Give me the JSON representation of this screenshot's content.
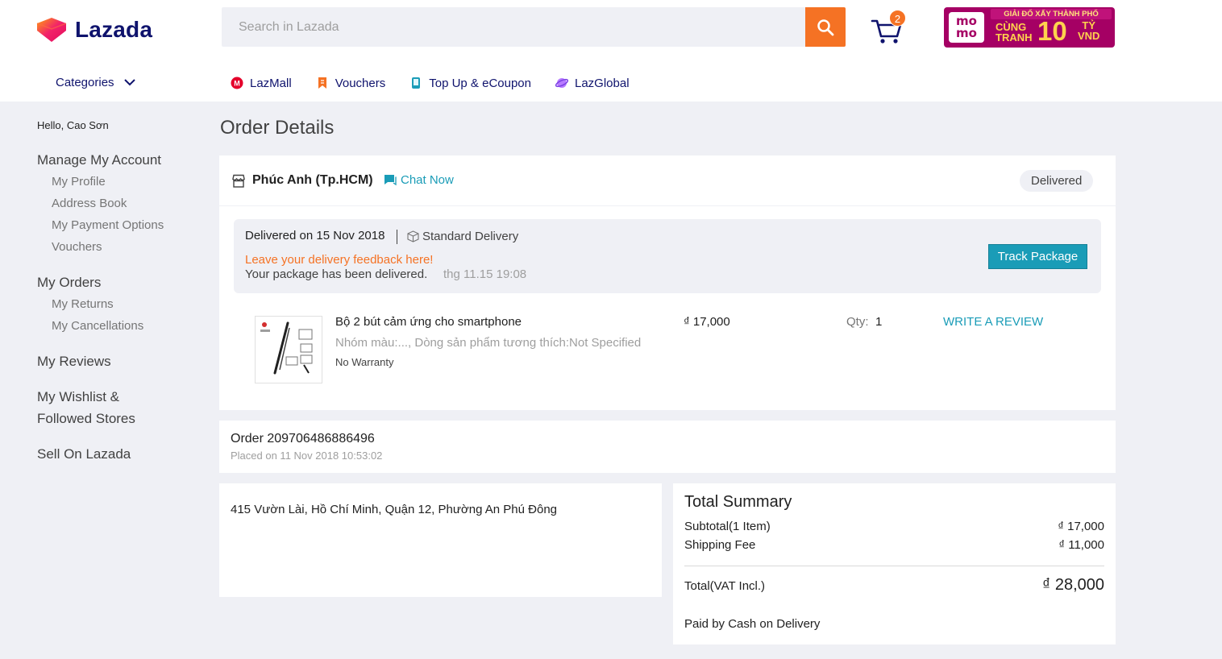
{
  "header": {
    "brand": "Lazada",
    "search": {
      "placeholder": "Search in Lazada",
      "value": ""
    },
    "cart_count": "2",
    "promo": {
      "line1": "GIẢI ĐỐ XẤY THÀNH PHỐ",
      "logo": "mo mo",
      "cung": "CÙNG",
      "tranh": "TRANH",
      "big": "10",
      "ty": "TỶ",
      "vnd": "VND"
    },
    "categories_label": "Categories",
    "nav": [
      {
        "label": "LazMall",
        "icon": "lazmall-icon",
        "color": "#e4002b"
      },
      {
        "label": "Vouchers",
        "icon": "voucher-icon",
        "color": "#f57224"
      },
      {
        "label": "Top Up & eCoupon",
        "icon": "topup-icon",
        "color": "#1a9cb7"
      },
      {
        "label": "LazGlobal",
        "icon": "lazglobal-icon",
        "color": "#7b3fe4"
      }
    ]
  },
  "sidebar": {
    "greeting": "Hello, Cao Sơn",
    "manage_account": "Manage My Account",
    "account_items": [
      "My Profile",
      "Address Book",
      "My Payment Options",
      "Vouchers"
    ],
    "my_orders": "My Orders",
    "order_items": [
      "My Returns",
      "My Cancellations"
    ],
    "my_reviews": "My Reviews",
    "wishlist_line1": "My Wishlist &",
    "wishlist_line2": "Followed Stores",
    "sell": "Sell On Lazada"
  },
  "page_title": "Order Details",
  "package": {
    "shop_name": "Phúc Anh (Tp.HCM)",
    "chat_label": "Chat Now",
    "status": "Delivered",
    "delivered_on": "Delivered on 15 Nov 2018",
    "delivery_type": "Standard Delivery",
    "feedback_link": "Leave your delivery feedback here!",
    "delivered_msg": "Your package has been delivered.",
    "delivered_time": "thg 11.15 19:08",
    "track_label": "Track Package",
    "item": {
      "name": "Bộ 2 bút cảm ứng cho smartphone",
      "variant": "Nhóm màu:..., Dòng sản phẩm tương thích:Not Specified",
      "warranty": "No Warranty",
      "price": "₫ 17,000",
      "qty_label": "Qty:",
      "qty": "1",
      "review_label": "WRITE A REVIEW"
    }
  },
  "order": {
    "number": "Order 209706486886496",
    "placed_on": "Placed on 11 Nov 2018 10:53:02"
  },
  "address": "415 Vườn Lài, Hồ Chí Minh, Quận 12, Phường An Phú Đông",
  "summary": {
    "title": "Total Summary",
    "subtotal_label": "Subtotal(1 Item)",
    "subtotal": "₫ 17,000",
    "shipping_label": "Shipping Fee",
    "shipping": "₫ 11,000",
    "total_label": "Total(VAT Incl.)",
    "total": "₫ 28,000",
    "paid_by": "Paid by Cash on Delivery"
  },
  "colors": {
    "accent": "#f57224",
    "link": "#1a9cb7",
    "brand_navy": "#0f136d",
    "background": "#eff0f5"
  }
}
